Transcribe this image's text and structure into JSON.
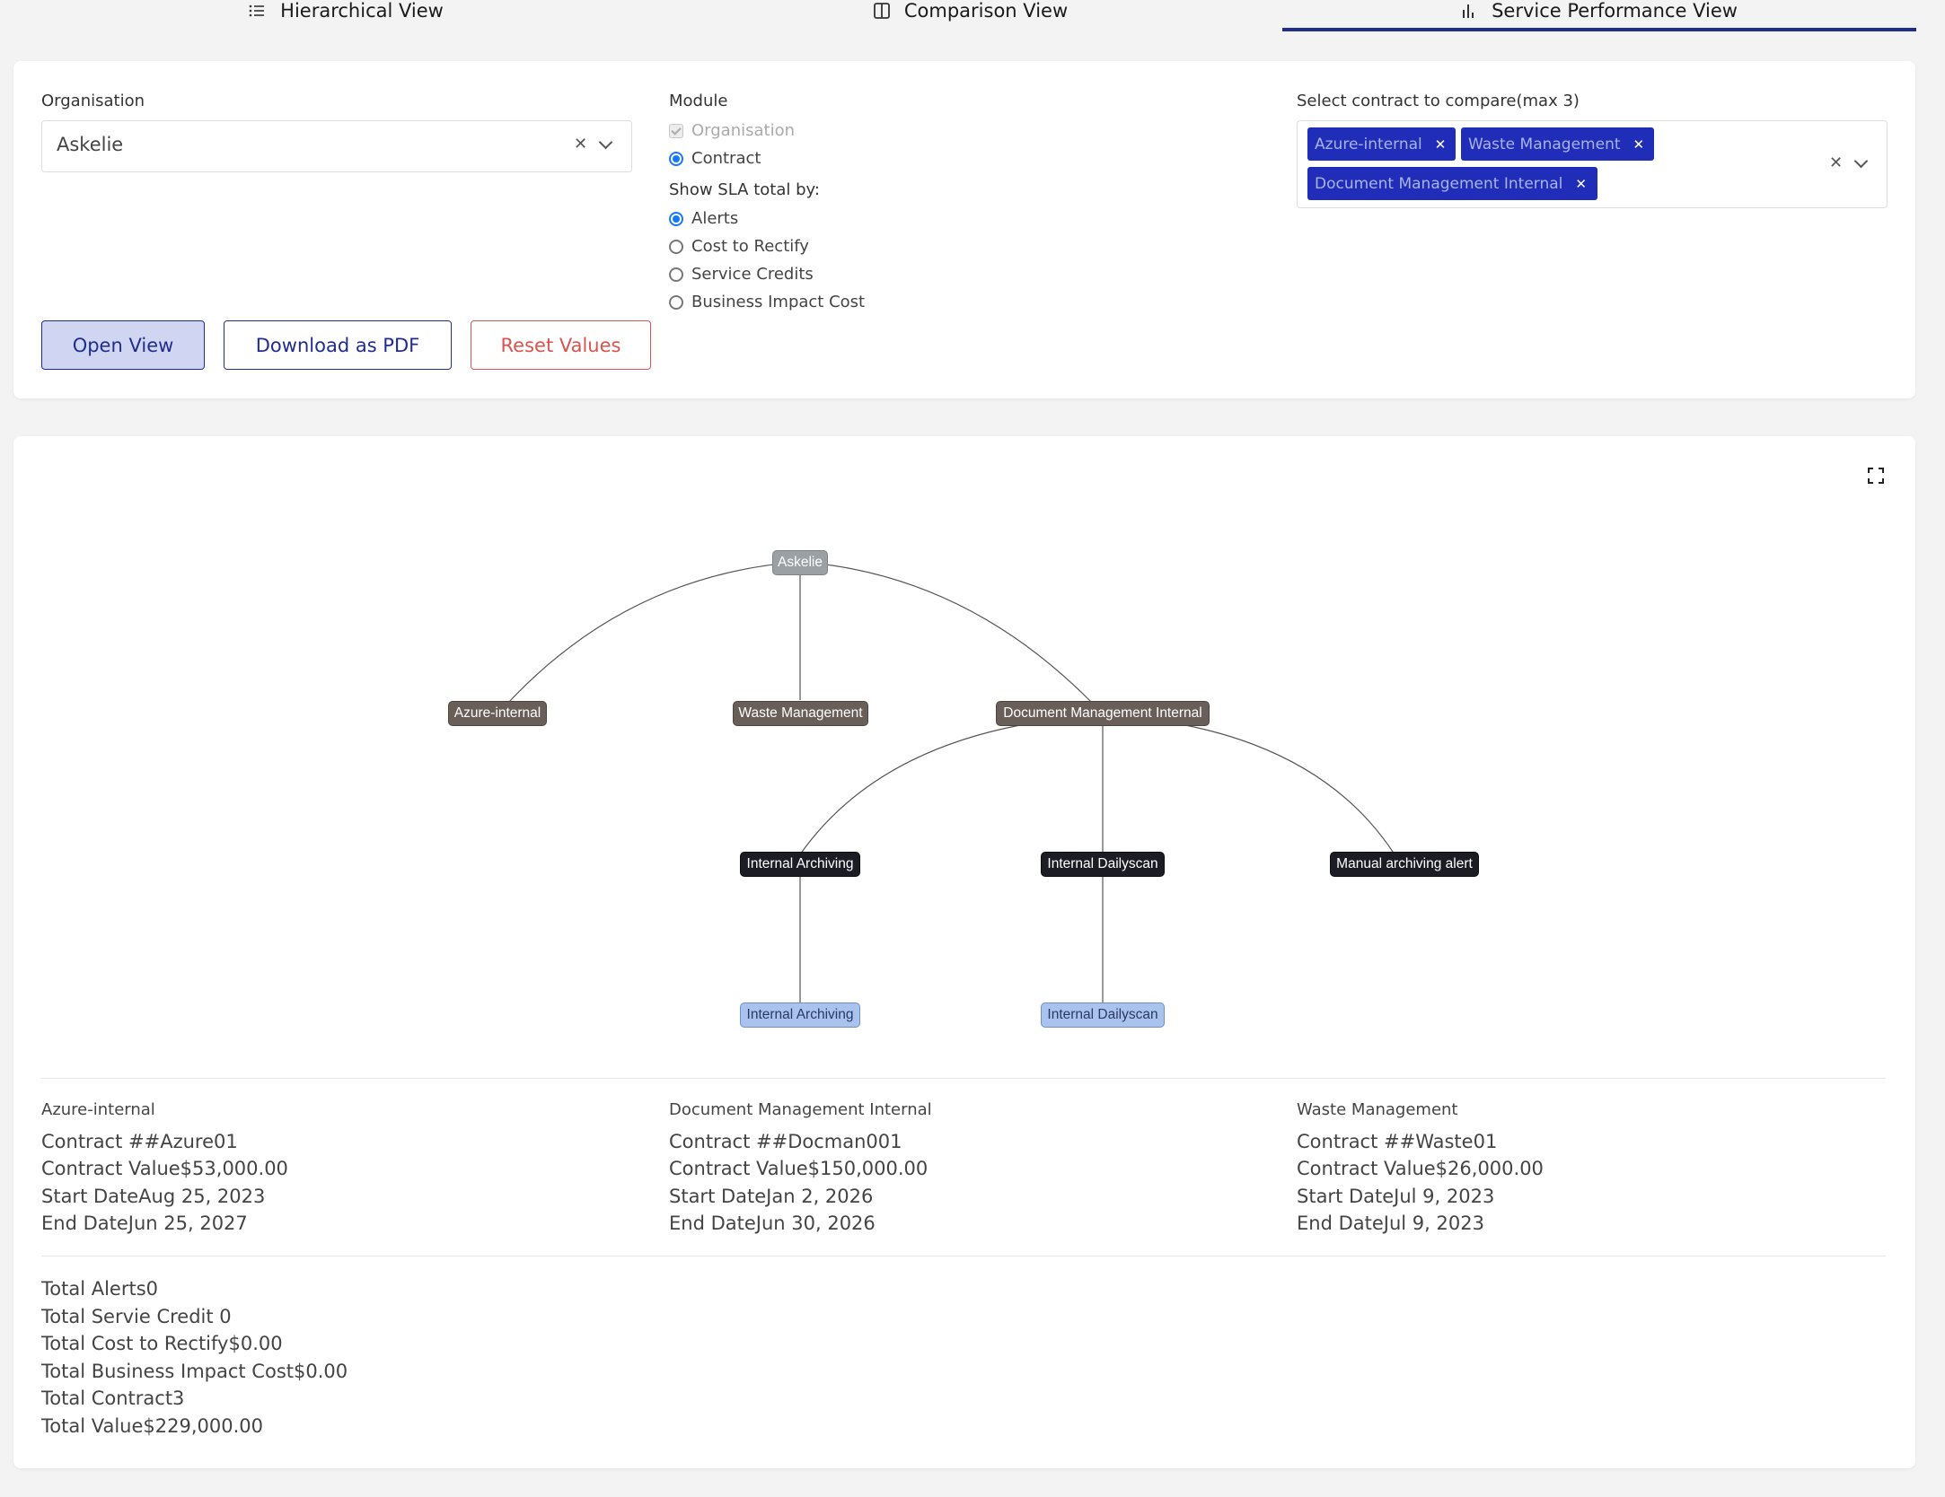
{
  "tabs": [
    {
      "label": "Hierarchical View",
      "icon": "list-icon",
      "active": false
    },
    {
      "label": "Comparison View",
      "icon": "columns-icon",
      "active": false
    },
    {
      "label": "Service Performance View",
      "icon": "bar-chart-icon",
      "active": true
    }
  ],
  "filters": {
    "organisation_label": "Organisation",
    "organisation_value": "Askelie",
    "module_label": "Module",
    "module_options": [
      {
        "label": "Organisation",
        "checked": true,
        "disabled": true
      },
      {
        "label": "Contract",
        "selected": true
      }
    ],
    "sla_label": "Show SLA total by:",
    "sla_options": [
      {
        "label": "Alerts",
        "selected": true
      },
      {
        "label": "Cost to Rectify",
        "selected": false
      },
      {
        "label": "Service Credits",
        "selected": false
      },
      {
        "label": "Business Impact Cost",
        "selected": false
      }
    ],
    "compare_label": "Select contract to compare(max 3)",
    "selected_contracts": [
      "Azure-internal",
      "Waste Management",
      "Document Management Internal"
    ]
  },
  "buttons": {
    "open_view": "Open View",
    "download_pdf": "Download as PDF",
    "reset_values": "Reset Values"
  },
  "graph": {
    "root": "Askelie",
    "contracts": [
      "Azure-internal",
      "Waste Management",
      "Document Management Internal"
    ],
    "alerts": [
      "Internal Archiving",
      "Internal Dailyscan",
      "Manual archiving alert"
    ],
    "leaves": [
      "Internal Archiving",
      "Internal Dailyscan"
    ]
  },
  "contract_details": [
    {
      "name": "Azure-internal",
      "contract": "Contract ##Azure01",
      "value": "Contract Value$53,000.00",
      "start": "Start DateAug 25, 2023",
      "end": "End DateJun 25, 2027"
    },
    {
      "name": "Document Management Internal",
      "contract": "Contract ##Docman001",
      "value": "Contract Value$150,000.00",
      "start": "Start DateJan 2, 2026",
      "end": "End DateJun 30, 2026"
    },
    {
      "name": "Waste Management",
      "contract": "Contract ##Waste01",
      "value": "Contract Value$26,000.00",
      "start": "Start DateJul 9, 2023",
      "end": "End DateJul 9, 2023"
    }
  ],
  "totals": [
    "Total Alerts0",
    "Total Servie Credit 0",
    "Total Cost to Rectify$0.00",
    "Total Business Impact Cost$0.00",
    "Total Contract3",
    "Total Value$229,000.00"
  ],
  "colors": {
    "accent": "#1f2d8e",
    "chip": "#1f2db8",
    "reset": "#d9534f",
    "radio": "#1677ff"
  }
}
